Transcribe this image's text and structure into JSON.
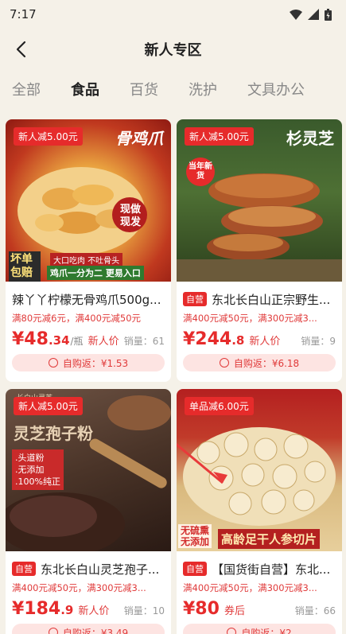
{
  "status": {
    "time": "7:17"
  },
  "nav": {
    "title": "新人专区"
  },
  "tabs": [
    "全部",
    "食品",
    "百货",
    "洗护",
    "文具办公"
  ],
  "products": [
    {
      "badge": "新人减5.00元",
      "img_text": [
        "骨鸡爪",
        "现做现发",
        "坏单包赔",
        "大口吃肉 不吐骨头",
        "鸡爪一分为二 更易入口"
      ],
      "self_run": "",
      "title": "辣丫丫柠檬无骨鸡爪500g...",
      "promo": "满80元减6元，满400元减50元",
      "price_int": "¥48",
      "price_dec": ".34",
      "unit": "/瓶",
      "tag": "新人价",
      "sales": "销量：61",
      "rebate": "自购返：¥1.53"
    },
    {
      "badge": "新人减5.00元",
      "img_text": [
        "杉灵芝",
        "当年新货"
      ],
      "self_run": "自营",
      "title": "东北长白山正宗野生...",
      "promo": "满400元减50元，满300元减3...",
      "price_int": "¥244",
      "price_dec": ".8",
      "unit": "",
      "tag": "新人价",
      "sales": "销量：9",
      "rebate": "自购返：¥6.18"
    },
    {
      "badge": "新人减5.00元",
      "img_text": [
        "灵芝孢子粉",
        ".头道粉",
        ".无添加",
        ".100%纯正",
        "长白山灵芝"
      ],
      "self_run": "自营",
      "title": "东北长白山灵芝孢子...",
      "promo": "满400元减50元，满300元减3...",
      "price_int": "¥184",
      "price_dec": ".9",
      "unit": "",
      "tag": "新人价",
      "sales": "销量：10",
      "rebate": "自购返：¥3.49"
    },
    {
      "badge": "单品减6.00元",
      "img_text": [
        "无硫熏",
        "无添加",
        "高龄足干人参切片"
      ],
      "self_run": "自营",
      "title": "【国货街自营】东北...",
      "promo": "满400元减50元，满300元减3...",
      "price_int": "¥80",
      "price_dec": "",
      "unit": "",
      "tag": "券后",
      "sales": "销量：66",
      "rebate": "自购返：¥2"
    }
  ],
  "colors": {
    "accent": "#e62b2b",
    "background": "#f5f1e8"
  }
}
